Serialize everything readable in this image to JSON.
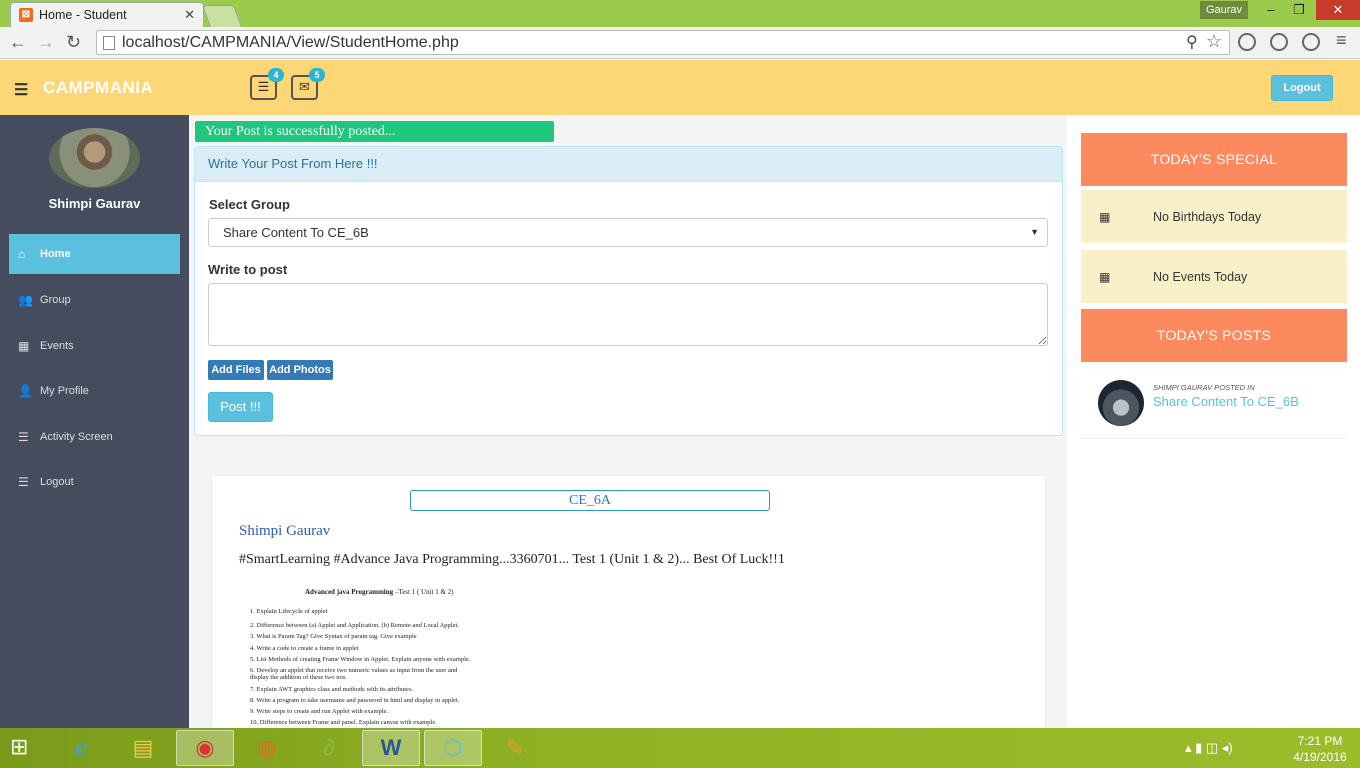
{
  "browser": {
    "tab_title": "Home - Student",
    "tab_close": "✕",
    "user": "Gaurav",
    "url": "localhost/CAMPMANIA/View/StudentHome.php"
  },
  "header": {
    "brand": "CAMPMANIA",
    "notifications_count": "4",
    "messages_count": "5",
    "logout_label": "Logout"
  },
  "sidebar": {
    "user_name": "Shimpi Gaurav",
    "items": [
      {
        "label": "Home",
        "icon": "home-icon"
      },
      {
        "label": "Group",
        "icon": "users-icon"
      },
      {
        "label": "Events",
        "icon": "calendar-icon"
      },
      {
        "label": "My Profile",
        "icon": "user-icon"
      },
      {
        "label": "Activity Screen",
        "icon": "list-icon"
      },
      {
        "label": "Logout",
        "icon": "list-icon"
      }
    ]
  },
  "main": {
    "success_message": "Your Post is successfully posted...",
    "panel_title": "Write Your Post From Here !!!",
    "select_group_label": "Select Group",
    "selected_group": "Share Content To CE_6B",
    "write_label": "Write to post",
    "add_files": "Add Files",
    "add_photos": "Add Photos",
    "post_button": "Post !!!"
  },
  "feed": {
    "group": "CE_6A",
    "author": "Shimpi Gaurav",
    "text": "#SmartLearning #Advance Java Programming...3360701... Test 1 (Unit 1 & 2)... Best Of Luck!!1",
    "doc_title": "Advanced java Programming",
    "doc_subtitle": " –Test 1 ( Unit 1 & 2)",
    "doc_lines": [
      "1.   Explain Lifecycle of applet",
      "2.   Difference between (a) Applet and Application. (b)  Remote and Local Applet.",
      "3.   What is Param Tag? Give Syntax of param tag. Give example",
      "4.   Write a code to create a frame in applet",
      "5.   List Methods of creating Frame Window in Applet. Explain anyone with example.",
      "6.   Develop an applet that receive two numeric values as input from the user and",
      "      display the addition of these two nos.",
      "7.   Explain AWT graphics class and methods with its attributes.",
      "8.   Write a program to take username and password in html and display in applet.",
      "9.   Write steps to create and run Applet with example.",
      "10. Difference between Frame and panel. Explain canvas with example."
    ]
  },
  "right": {
    "special_title": "TODAY'S SPECIAL",
    "birthdays": "No Birthdays Today",
    "events": "No Events Today",
    "posts_title": "TODAY'S POSTS",
    "post_by": "SHIMPI GAURAV POSTED IN",
    "post_group": "Share Content To CE_6B"
  },
  "taskbar": {
    "time": "7:21 PM",
    "date": "4/19/2016"
  }
}
